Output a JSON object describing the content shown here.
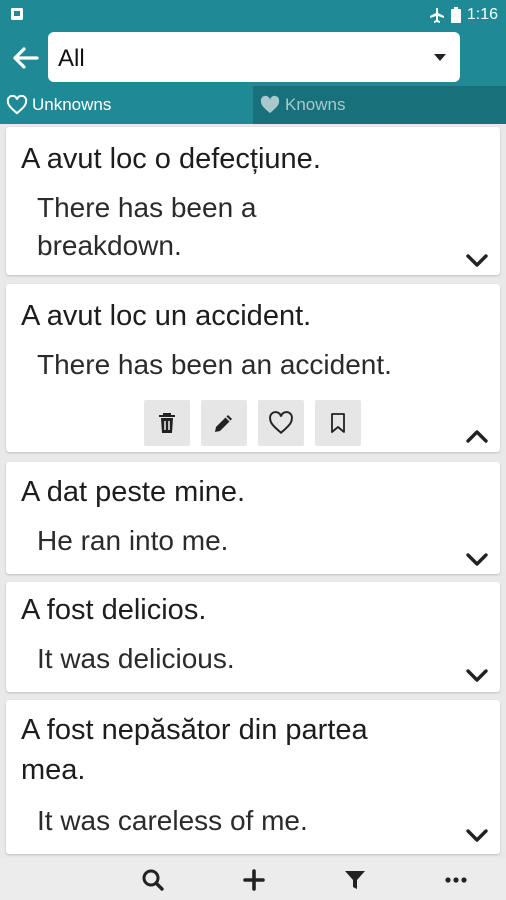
{
  "status_bar": {
    "time": "1:16"
  },
  "header": {
    "back_icon": "arrow-left-icon",
    "filter_selected": "All"
  },
  "tabs": [
    {
      "label": "Unknowns",
      "icon": "heart-outline-icon",
      "active": true
    },
    {
      "label": "Knowns",
      "icon": "heart-filled-icon",
      "active": false
    }
  ],
  "cards": [
    {
      "romanian": "A avut loc o defecțiune.",
      "english_line1": "There has been a",
      "english_line2": "breakdown.",
      "expanded": false
    },
    {
      "romanian": "A avut loc un accident.",
      "english": "There has been an accident.",
      "expanded": true,
      "actions": [
        "trash-icon",
        "pencil-icon",
        "heart-outline-icon",
        "bookmark-icon"
      ]
    },
    {
      "romanian": "A dat peste mine.",
      "english": "He ran into me.",
      "expanded": false
    },
    {
      "romanian": "A fost delicios.",
      "english": "It was delicious.",
      "expanded": false
    },
    {
      "romanian_line1": "A fost nepăsător din partea",
      "romanian_line2": "mea.",
      "english": "It was careless of me.",
      "expanded": false
    }
  ],
  "bottom_bar": {
    "icons": [
      "search-icon",
      "plus-icon",
      "filter-icon",
      "more-icon"
    ]
  },
  "colors": {
    "primary": "#1f8a96",
    "primary_dark": "#17707a",
    "background": "#e9e9e9"
  }
}
